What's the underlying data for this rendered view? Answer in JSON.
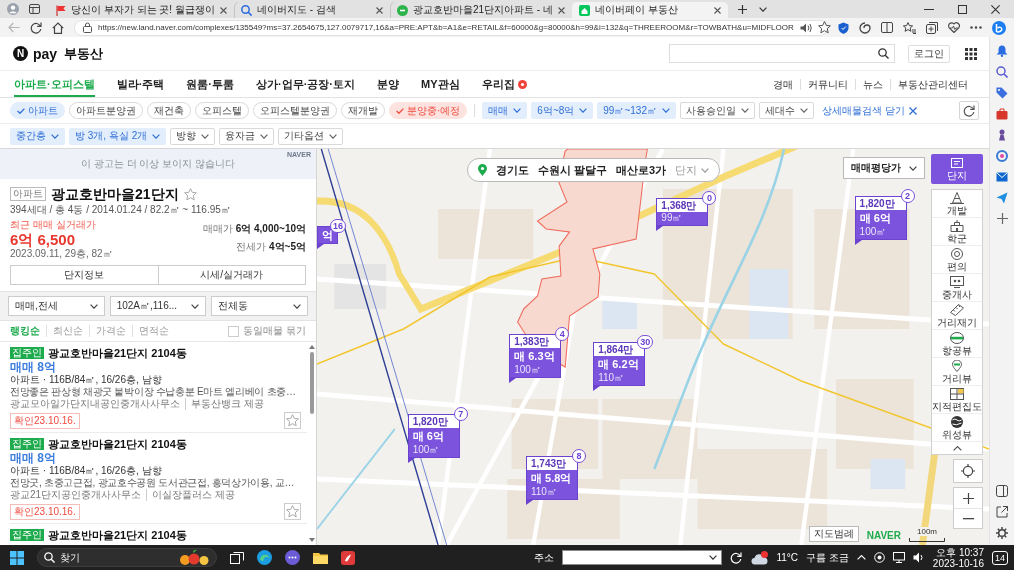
{
  "browser": {
    "tabs": [
      {
        "title": "당신이 부자가 되는 곳! 월급쟁이",
        "selected": false
      },
      {
        "title": "네이버지도 - 검색",
        "selected": false
      },
      {
        "title": "광교호반마을21단지아파트 - 네",
        "selected": false
      },
      {
        "title": "네이버페이 부동산",
        "selected": true
      }
    ],
    "url": "https://new.land.naver.com/complexes/135549?ms=37.2654675,127.0079717,16&a=PRE:APT&b=A1&e=RETAIL&f=60000&g=80000&h=99&i=132&q=THREEROOM&r=TOWBATH&u=MIDFLOOR"
  },
  "header": {
    "logo": {
      "mark": "N",
      "brand": "pay",
      "service": "부동산"
    },
    "login": "로그인"
  },
  "nav": {
    "tabs": [
      {
        "label": "아파트·오피스텔",
        "selected": true,
        "new": false
      },
      {
        "label": "빌라·주택",
        "selected": false,
        "new": false
      },
      {
        "label": "원룸·투룸",
        "selected": false,
        "new": false
      },
      {
        "label": "상가·업무·공장·토지",
        "selected": false,
        "new": false
      },
      {
        "label": "분양",
        "selected": false,
        "new": false
      },
      {
        "label": "MY관심",
        "selected": false,
        "new": false
      },
      {
        "label": "우리집",
        "selected": false,
        "new": true
      }
    ],
    "links": [
      "경매",
      "커뮤니티",
      "뉴스",
      "부동산관리센터"
    ]
  },
  "filters": {
    "types": [
      {
        "label": "아파트",
        "selected": true
      },
      {
        "label": "아파트분양권",
        "selected": false
      },
      {
        "label": "재건축",
        "selected": false
      },
      {
        "label": "오피스텔",
        "selected": false
      },
      {
        "label": "오피스텔분양권",
        "selected": false
      },
      {
        "label": "재개발",
        "selected": false
      }
    ],
    "sale_status": {
      "label": "분양중·예정",
      "selected": true
    },
    "dropdowns": [
      {
        "label": "매매",
        "active": true
      },
      {
        "label": "6억~8억",
        "active": true
      },
      {
        "label": "99㎡~132㎡",
        "active": true
      },
      {
        "label": "사용승인일",
        "active": false
      },
      {
        "label": "세대수",
        "active": false
      }
    ],
    "detail_toggle": "상세매물검색 닫기",
    "more_dropdowns": [
      {
        "label": "중간층",
        "active": true
      },
      {
        "label": "방 3개, 욕실 2개",
        "active": true
      },
      {
        "label": "방향",
        "active": false
      },
      {
        "label": "융자금",
        "active": false
      },
      {
        "label": "기타옵션",
        "active": false
      }
    ]
  },
  "ad": {
    "brand": "NAVER",
    "message": "이 광고는 더 이상 보이지 않습니다"
  },
  "complex": {
    "type": "아파트",
    "name": "광교호반마을21단지",
    "favorite": false,
    "summary": "394세대 / 총 4동 / 2014.01.24 / 82.2㎡ ~ 116.95㎡",
    "recent_label": "최근 매매 실거래가",
    "recent_price": "6억 6,500",
    "recent_detail": "2023.09.11, 29층, 82㎡",
    "prices": [
      {
        "label": "매매가",
        "value": "6억 4,000~10억"
      },
      {
        "label": "전세가",
        "value": "4억~5억"
      }
    ],
    "buttons": [
      "단지정보",
      "시세/실거래가"
    ]
  },
  "listing_filters": [
    "매매,전세",
    "102A㎡,116...",
    "전체동"
  ],
  "sort": {
    "options": [
      {
        "label": "랭킹순",
        "selected": true
      },
      {
        "label": "최신순",
        "selected": false
      },
      {
        "label": "가격순",
        "selected": false
      },
      {
        "label": "면적순",
        "selected": false
      }
    ],
    "group_same": {
      "label": "동일매물 묶기",
      "checked": false
    }
  },
  "listings": [
    {
      "tag": "집주인",
      "title": "광교호반마을21단지 2104동",
      "price": "매매 8억",
      "spec": "아파트 · 116B/84㎡, 16/26층, 남향",
      "description": "전망좋은 판상형 채광굿 붙박이장 수납충분 E마트 엘리베이 초중…",
      "agency": "광교모아일가단지내공인중개사사무소",
      "source": "부동산뱅크 제공",
      "confirmed": "확인23.10.16.",
      "favorite": false
    },
    {
      "tag": "집주인",
      "title": "광교호반마을21단지 2104동",
      "price": "매매 8억",
      "spec": "아파트 · 116B/84㎡, 16/26층, 남향",
      "description": "전망굿, 초중고근접, 광교호수공원 도서관근접, 흥덕상가이용, 교…",
      "agency": "광교21단지공인중개사사무소",
      "source": "이실장플러스 제공",
      "confirmed": "확인23.10.16.",
      "favorite": false
    },
    {
      "tag": "집주인",
      "title": "광교호반마을21단지 2104동"
    }
  ],
  "map": {
    "location": [
      "경기도",
      "수원시 팔달구",
      "매산로3가"
    ],
    "level": "단지",
    "price_type": "매매평당가",
    "complex_toggle": "단지",
    "markers": [
      {
        "count": "16",
        "price": "억"
      },
      {
        "unit_price": "1,383만",
        "count": "4",
        "price": "매 6.3억",
        "area": "100㎡"
      },
      {
        "unit_price": "1,864만",
        "count": "30",
        "price": "매 6.2억",
        "area": "110㎡"
      },
      {
        "unit_price": "1,820만",
        "count": "7",
        "price": "매 6억",
        "area": "100㎡"
      },
      {
        "unit_price": "1,743만",
        "count": "8",
        "price": "매 5.8억",
        "area": "110㎡"
      },
      {
        "unit_price": "1,368만",
        "count": "0",
        "area": "99㎡"
      },
      {
        "unit_price": "1,820만",
        "count": "2",
        "price": "매 6억",
        "area": "100㎡"
      }
    ],
    "tools": [
      "개발",
      "학군",
      "편의",
      "중개사",
      "거리재기",
      "항공뷰",
      "거리뷰",
      "지적편집도",
      "위성뷰"
    ],
    "legend": "지도범례",
    "brand": "NAVER",
    "scale": "100m"
  },
  "taskbar": {
    "search": {
      "placeholder": "찾기"
    },
    "address_label": "주소",
    "weather": {
      "temperature": "11°C",
      "condition": "구름 조금"
    },
    "time": "오후 10:37",
    "date": "2023-10-16",
    "notifications": "14"
  }
}
